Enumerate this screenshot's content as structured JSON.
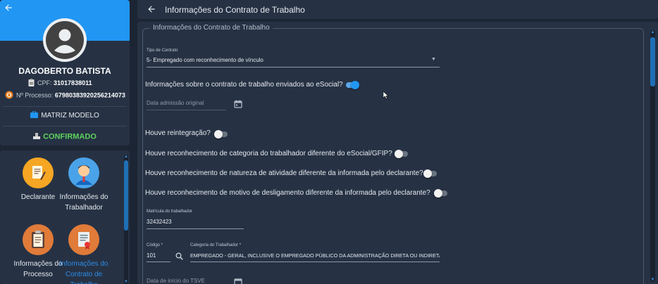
{
  "profile": {
    "name": "DAGOBERTO BATISTA",
    "cpf_label": "CPF:",
    "cpf": "31017838011",
    "process_label": "Nº Processo:",
    "process": "67980383920256214073",
    "template_label": "MATRIZ MODELO",
    "status_label": "CONFIRMADO",
    "status_color": "#5ed35e",
    "banner_color": "#2196f3"
  },
  "menu": {
    "items": [
      {
        "label": "Declarante",
        "icon": "document-pen-icon"
      },
      {
        "label": "Informações do Trabalhador",
        "icon": "worker-avatar-icon"
      },
      {
        "label": "Informações do Processo",
        "icon": "clipboard-icon"
      },
      {
        "label": "Informações do Contrato de Trabalho",
        "icon": "contract-icon",
        "active": true
      }
    ]
  },
  "header": {
    "title": "Informações do Contrato de Trabalho"
  },
  "form": {
    "section_title": "Informações do Contrato de Trabalho",
    "contract_type": {
      "label": "Tipo de Contrato",
      "value": "5- Empregado com reconhecimento de vínculo"
    },
    "esocial_question": "Informações sobre o contrato de trabalho enviados ao eSocial?",
    "admission_date_placeholder": "Data admissão original",
    "reinstatement_question": "Houve reintegração?",
    "category_question": "Houve reconhecimento de categoria do trabalhador diferente do eSocial/GFIP?",
    "nature_question": "Houve reconhecimento de natureza de atividade diferente da informada pelo declarante?",
    "dismissal_question": "Houve reconhecimento de motivo de desligamento diferente da informada pelo declarante?",
    "registration": {
      "label": "Matrícula do trabalhador",
      "value": "32432423"
    },
    "code": {
      "label": "Código *",
      "value": "101"
    },
    "category": {
      "label": "Categoria do Trabalhador *",
      "value": "EMPREGADO - GERAL, INCLUSIVE O EMPREGADO PÚBLICO DA ADMINISTRAÇÃO DIRETA OU INDIRETA"
    },
    "tsve_start_placeholder": "Data de início do TSVE"
  },
  "toggles": {
    "esocial": true,
    "reinstatement": false,
    "category": false,
    "nature": false,
    "dismissal": false
  },
  "colors": {
    "accent": "#2196f3",
    "status_green": "#5ed35e",
    "panel": "#263244",
    "background": "#1c2533"
  }
}
